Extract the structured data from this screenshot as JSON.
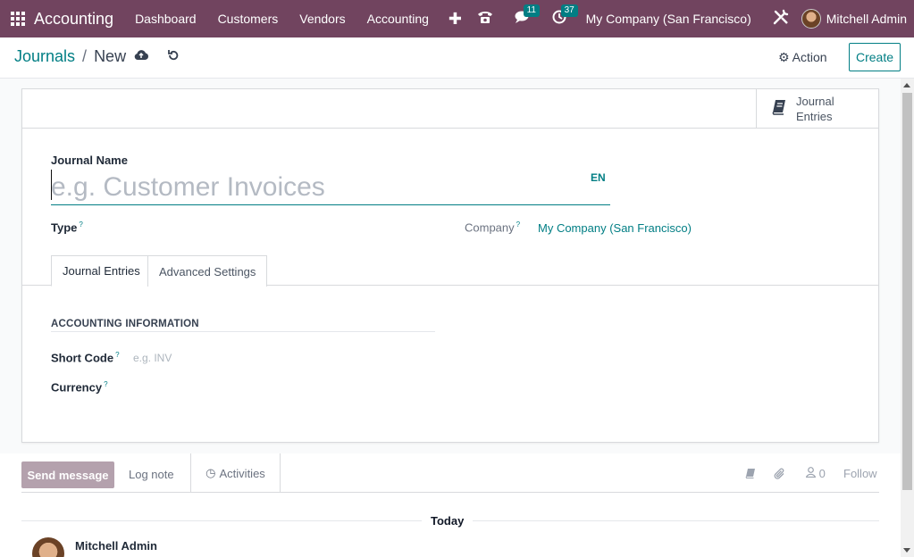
{
  "navbar": {
    "brand": "Accounting",
    "menu": [
      "Dashboard",
      "Customers",
      "Vendors",
      "Accounting"
    ],
    "plus_icon": "plus-icon",
    "messages_badge": "11",
    "activities_badge": "37",
    "company": "My Company (San Francisco)",
    "user": "Mitchell Admin"
  },
  "control": {
    "breadcrumb_parent": "Journals",
    "breadcrumb_sep": "/",
    "breadcrumb_current": "New",
    "action_label": "⚙ Action",
    "create_label": "Create"
  },
  "sheet": {
    "stat_button_label": "Journal Entries",
    "journal_name_label": "Journal Name",
    "journal_name_placeholder": "e.g. Customer Invoices",
    "lang": "EN",
    "type_label": "Type",
    "company_label": "Company",
    "company_value": "My Company (San Francisco)",
    "tabs": [
      "Journal Entries",
      "Advanced Settings"
    ],
    "section_title": "ACCOUNTING INFORMATION",
    "short_code_label": "Short Code",
    "short_code_placeholder": "e.g. INV",
    "currency_label": "Currency",
    "help_mark": "?"
  },
  "chatter": {
    "send_message": "Send message",
    "log_note": "Log note",
    "activities": "Activities",
    "followers_count": "0",
    "follow": "Follow",
    "today": "Today",
    "author": "Mitchell Admin"
  },
  "colors": {
    "navbar": "#71445f",
    "accent": "#017e84",
    "send_button": "#b4a1ad"
  }
}
